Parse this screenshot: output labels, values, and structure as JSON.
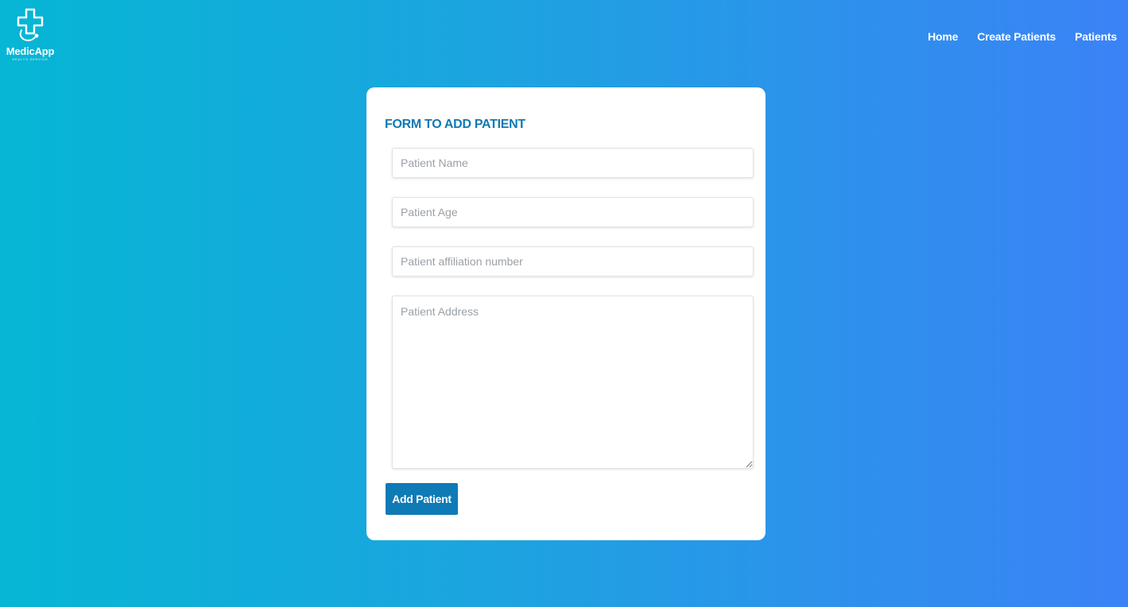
{
  "brand": {
    "name": "MedicApp",
    "tagline": "HEALTH SERVICE",
    "logo_icon": "medical-cross-stethoscope-icon"
  },
  "nav": {
    "items": [
      {
        "label": "Home"
      },
      {
        "label": "Create Patients"
      },
      {
        "label": "Patients"
      }
    ]
  },
  "form": {
    "title": "FORM TO ADD PATIENT",
    "fields": {
      "name": {
        "placeholder": "Patient Name",
        "value": ""
      },
      "age": {
        "placeholder": "Patient Age",
        "value": ""
      },
      "affiliation": {
        "placeholder": "Patient affiliation number",
        "value": ""
      },
      "address": {
        "placeholder": "Patient Address",
        "value": ""
      }
    },
    "submit_label": "Add Patient"
  },
  "colors": {
    "gradient_start": "#06b6d4",
    "gradient_end": "#3b82f6",
    "accent": "#0e7ab6",
    "card": "#ffffff"
  }
}
